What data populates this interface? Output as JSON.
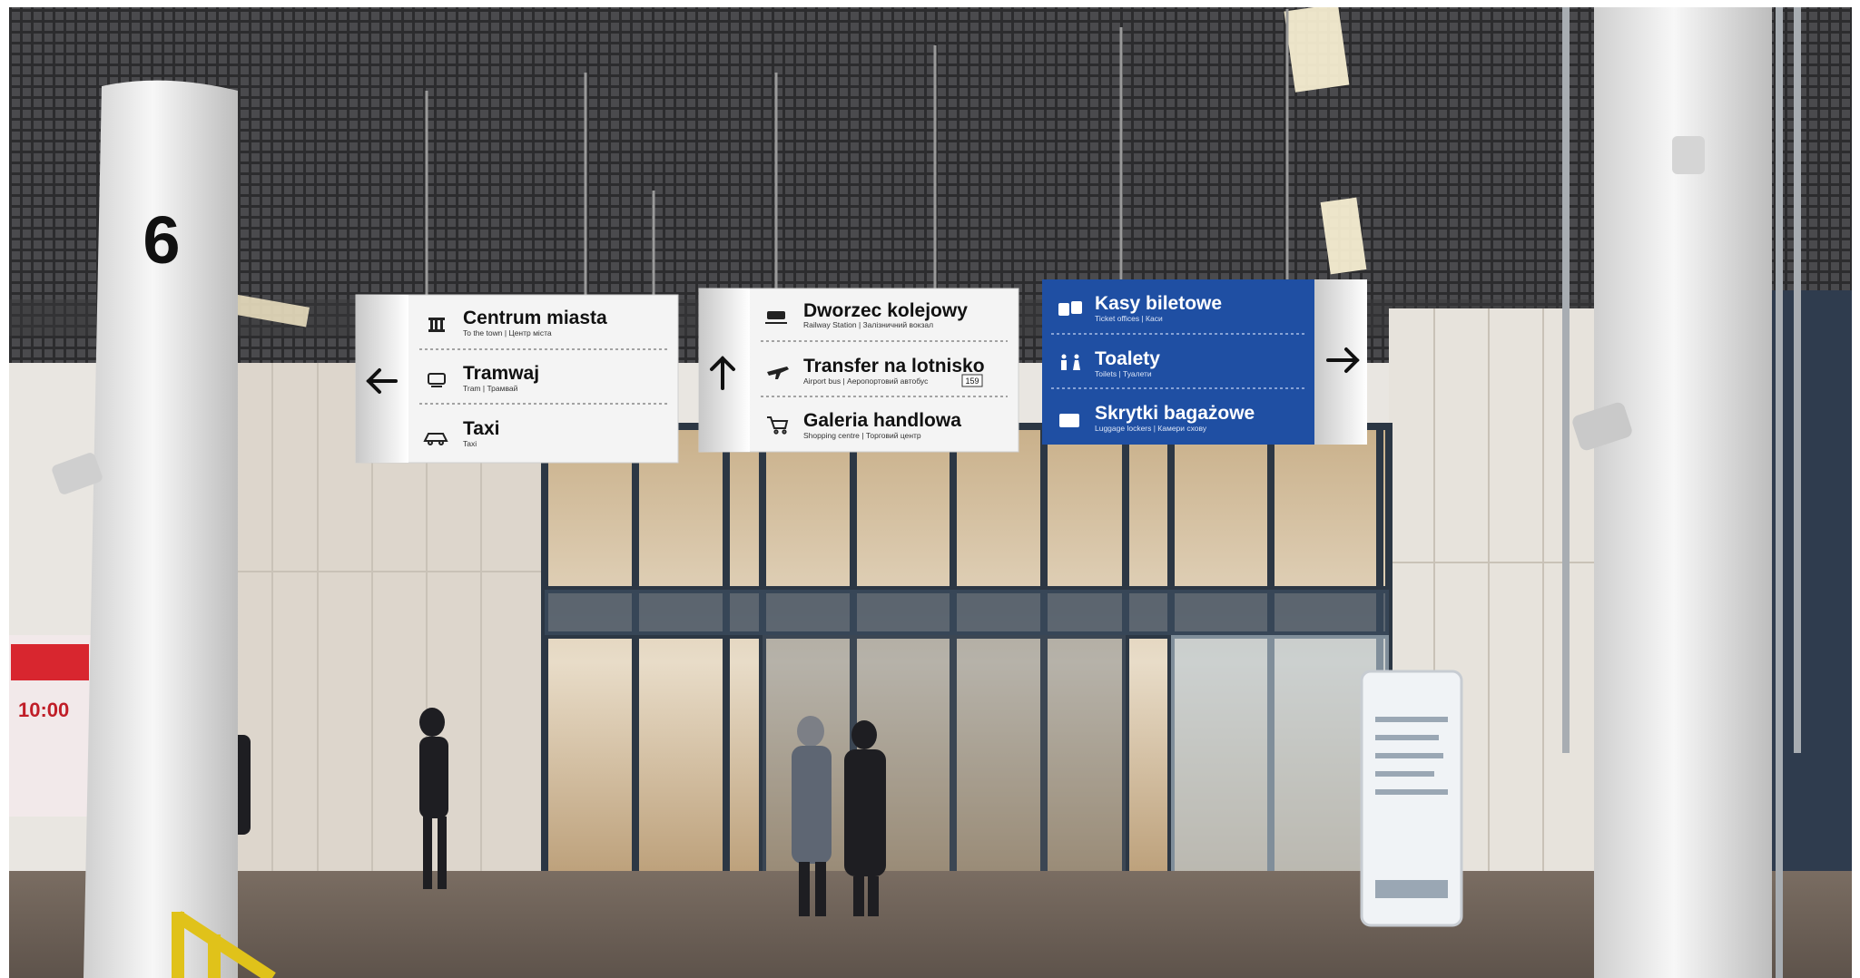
{
  "pillar_number": "6",
  "sign_left": {
    "arrow": "arrow-left-icon",
    "items": [
      {
        "icon": "building-icon",
        "title": "Centrum miasta",
        "subtitle": "To the town | Центр міста"
      },
      {
        "icon": "tram-icon",
        "title": "Tramwaj",
        "subtitle": "Tram | Трамвай"
      },
      {
        "icon": "taxi-icon",
        "title": "Taxi",
        "subtitle": "Taxi"
      }
    ]
  },
  "sign_middle": {
    "arrow": "arrow-up-icon",
    "items": [
      {
        "icon": "train-icon",
        "title": "Dworzec kolejowy",
        "subtitle": "Railway Station | Залізничний вокзал"
      },
      {
        "icon": "plane-icon",
        "title": "Transfer na lotnisko",
        "subtitle": "Airport bus | Аеропортовий автобус",
        "badge": "159"
      },
      {
        "icon": "cart-icon",
        "title": "Galeria handlowa",
        "subtitle": "Shopping centre | Торговий центр"
      }
    ]
  },
  "sign_right": {
    "arrow": "arrow-right-icon",
    "items": [
      {
        "icon": "ticket-icon",
        "title": "Kasy biletowe",
        "subtitle": "Ticket offices | Каси"
      },
      {
        "icon": "toilet-icon",
        "title": "Toalety",
        "subtitle": "Toilets | Туалети"
      },
      {
        "icon": "locker-icon",
        "title": "Skrytki bagażowe",
        "subtitle": "Luggage lockers | Камери схову"
      }
    ]
  },
  "colors": {
    "sign_blue": "#1f4fa3",
    "sign_white": "#f4f4f4",
    "ceiling": "#3a3a3c",
    "floor": "#6e6259",
    "glass_frame": "#2c3744"
  }
}
